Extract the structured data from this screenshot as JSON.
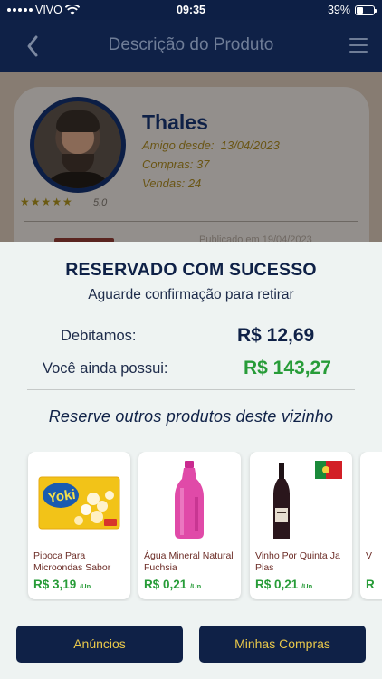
{
  "status": {
    "carrier": "VIVO",
    "time": "09:35",
    "battery": "39%",
    "battery_level": 0.39
  },
  "header": {
    "title": "Descrição do Produto",
    "back_icon": "chevron-left-icon",
    "menu_icon": "hamburger-menu-icon"
  },
  "seller": {
    "name": "Thales",
    "friend_since_label": "Amigo desde:",
    "friend_since": "13/04/2023",
    "purchases": "Compras: 37",
    "sales": "Vendas: 24",
    "stars": "★★★★★",
    "rating": "5.0",
    "partial_text": "Publicado em 19/04/2023"
  },
  "sheet": {
    "title": "RESERVADO COM SUCESSO",
    "subtitle": "Aguarde confirmação para retirar",
    "debited_label": "Debitamos:",
    "debited_value": "R$ 12,69",
    "balance_label": "Você ainda possui:",
    "balance_value": "R$ 143,27",
    "reserve_more": "Reserve outros produtos deste vizinho"
  },
  "products": [
    {
      "name": "Pipoca Para Microondas Sabor",
      "price": "R$ 3,19",
      "unit": "/Un"
    },
    {
      "name": "Água Mineral Natural Fuchsia",
      "price": "R$ 0,21",
      "unit": "/Un"
    },
    {
      "name": "Vinho Por Quinta Ja Pias",
      "price": "R$ 0,21",
      "unit": "/Un"
    },
    {
      "name": "V",
      "price": "R",
      "unit": ""
    }
  ],
  "buttons": {
    "ads": "Anúncios",
    "purchases": "Minhas Compras"
  },
  "colors": {
    "navy": "#0f2147",
    "green": "#279c38",
    "gold": "#e9c84a",
    "product_name": "#6b2b25"
  }
}
